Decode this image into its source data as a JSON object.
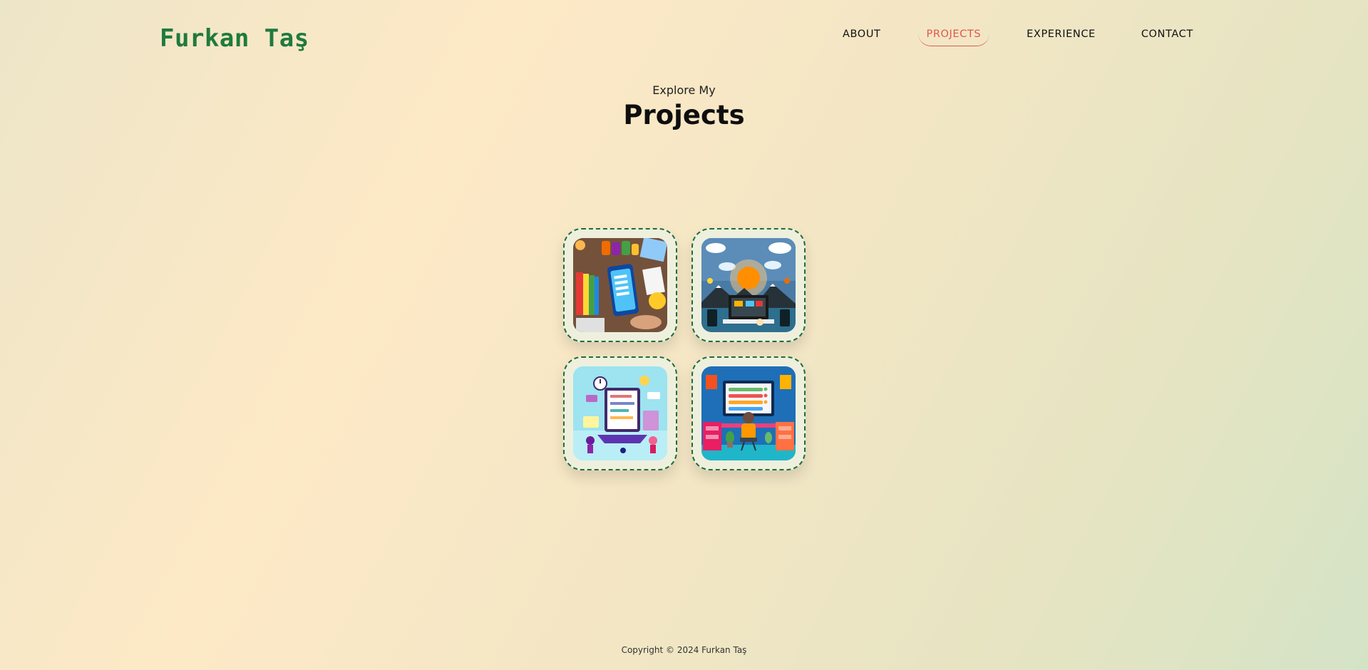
{
  "header": {
    "logo": "Furkan Taş",
    "nav": [
      {
        "label": "ABOUT",
        "active": false
      },
      {
        "label": "PROJECTS",
        "active": true
      },
      {
        "label": "EXPERIENCE",
        "active": false
      },
      {
        "label": "CONTACT",
        "active": false
      }
    ]
  },
  "hero": {
    "subtitle": "Explore My",
    "title": "Projects"
  },
  "projects": [
    {
      "image": "todo-app-desk-illustration-image"
    },
    {
      "image": "weather-app-illustration-image"
    },
    {
      "image": "task-planner-laptop-illustration-image"
    },
    {
      "image": "developer-workstation-illustration-image"
    }
  ],
  "footer": {
    "copyright": "Copyright © 2024 Furkan Taş"
  },
  "colors": {
    "logo": "#1f7a3d",
    "active_nav": "#e2574c",
    "card_border": "#1f6e35"
  }
}
